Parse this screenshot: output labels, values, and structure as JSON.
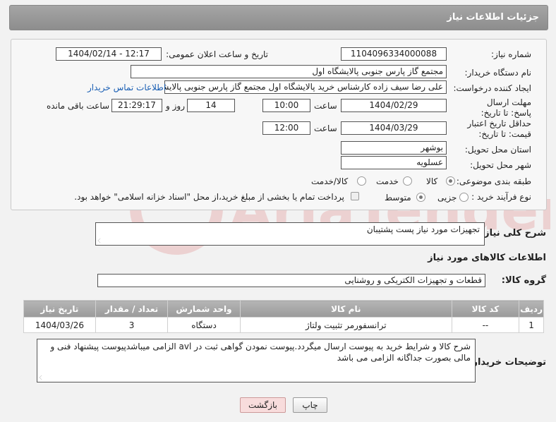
{
  "header": {
    "title": "جزئیات اطلاعات نیاز"
  },
  "form": {
    "need_number_label": "شماره نیاز:",
    "need_number": "1104096334000088",
    "announce_label": "تاریخ و ساعت اعلان عمومی:",
    "announce_value": "1404/02/14 - 12:17",
    "buyer_org_label": "نام دستگاه خریدار:",
    "buyer_org": "مجتمع گاز پارس جنوبی  پالایشگاه اول",
    "requester_label": "ایجاد کننده درخواست:",
    "requester": "علی رضا سیف زاده کارشناس خرید پالایشگاه اول مجتمع گاز پارس جنوبی  پالایشگاه",
    "contact_link": "اطلاعات تماس خریدار",
    "reply_deadline_label": "مهلت ارسال پاسخ: تا تاریخ:",
    "reply_date": "1404/02/29",
    "time_label": "ساعت",
    "reply_time": "10:00",
    "days_value": "14",
    "days_label": "روز و",
    "remaining_time": "21:29:17",
    "remaining_label": "ساعت باقی مانده",
    "price_deadline_label": "حداقل تاریخ اعتبار قیمت: تا تاریخ:",
    "price_date": "1404/03/29",
    "price_time": "12:00",
    "province_label": "استان محل تحویل:",
    "province": "بوشهر",
    "city_label": "شهر محل تحویل:",
    "city": "عسلویه",
    "category_label": "طبقه بندی موضوعی:",
    "category_options": [
      "کالا",
      "خدمت",
      "کالا/خدمت"
    ],
    "category_selected": "کالا",
    "process_label": "نوع فرآیند خرید :",
    "process_options": [
      "جزیی",
      "متوسط"
    ],
    "process_selected": "متوسط",
    "payment_note": "پرداخت تمام یا بخشی از مبلغ خرید،از محل \"اسناد خزانه اسلامی\" خواهد بود."
  },
  "description": {
    "label": "شرح کلی نیاز:",
    "value": "تجهیزات مورد نیاز پست پشتیبان"
  },
  "goods": {
    "section_title": "اطلاعات کالاهای مورد نیاز",
    "group_label": "گروه کالا:",
    "group_value": "قطعات و تجهیزات الکتریکی و روشنایی",
    "table_headers": [
      "ردیف",
      "کد کالا",
      "نام کالا",
      "واحد شمارش",
      "تعداد / مقدار",
      "تاریخ نیاز"
    ],
    "rows": [
      [
        "1",
        "--",
        "ترانسفورمر تثبیت ولتاژ",
        "دستگاه",
        "3",
        "1404/03/26"
      ]
    ]
  },
  "buyer_notes": {
    "label": "توضیحات خریدار:",
    "value": "شرح کالا و شرایط خرید به پیوست ارسال میگردد.پیوست نمودن گواهی ثبت در avl الزامی میباشدپیوست پیشنهاد فنی و مالی بصورت جداگانه الزامی می باشد"
  },
  "buttons": {
    "print": "چاپ",
    "back": "بازگشت"
  },
  "watermark": {
    "text": "AriaTender.neT"
  },
  "colors": {
    "header": "#999999",
    "link": "#1a5fb4",
    "back_button": "#f8dcdc"
  }
}
